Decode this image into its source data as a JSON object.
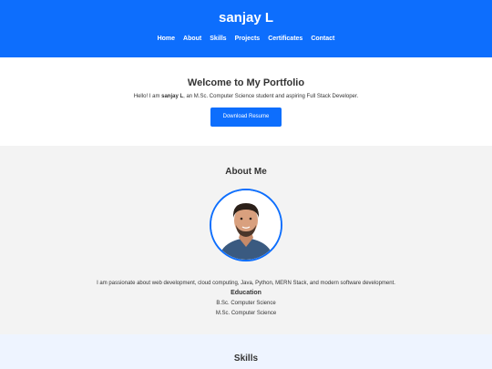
{
  "header": {
    "site_title": "sanjay L",
    "nav": [
      "Home",
      "About",
      "Skills",
      "Projects",
      "Certificates",
      "Contact"
    ]
  },
  "hero": {
    "title": "Welcome to My Portfolio",
    "intro_before": "Hello! I am ",
    "intro_name": "sanjay L",
    "intro_after": ", an M.Sc. Computer Science student and aspiring Full Stack Developer.",
    "button_label": "Download Resume"
  },
  "about": {
    "title": "About Me",
    "description": "I am passionate about web development, cloud computing, Java, Python, MERN Stack, and modern software development.",
    "education_title": "Education",
    "education": [
      "B.Sc. Computer Science",
      "M.Sc. Computer Science"
    ]
  },
  "skills": {
    "title": "Skills"
  },
  "colors": {
    "primary": "#0d6efd",
    "section_grey": "#f3f3f3",
    "skills_bg": "#eef4ff"
  }
}
